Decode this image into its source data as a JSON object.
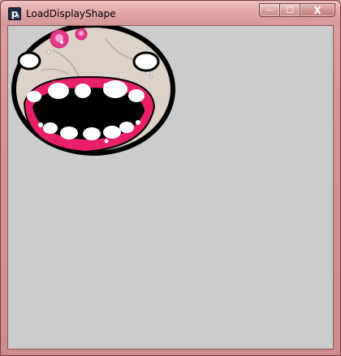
{
  "window": {
    "title": "LoadDisplayShape",
    "app_icon_letter": "p",
    "app_icon_sub": "5",
    "buttons": {
      "minimize_label": "—",
      "maximize_label": "☐",
      "close_label": "X"
    }
  },
  "canvas": {
    "background": "#cccccc",
    "shape_name": "monster-shape"
  },
  "colors": {
    "frame": "#d49494",
    "mouth_pink": "#e8206a",
    "skin": "#dcd2c8",
    "eye_pink": "#e43a8c"
  }
}
